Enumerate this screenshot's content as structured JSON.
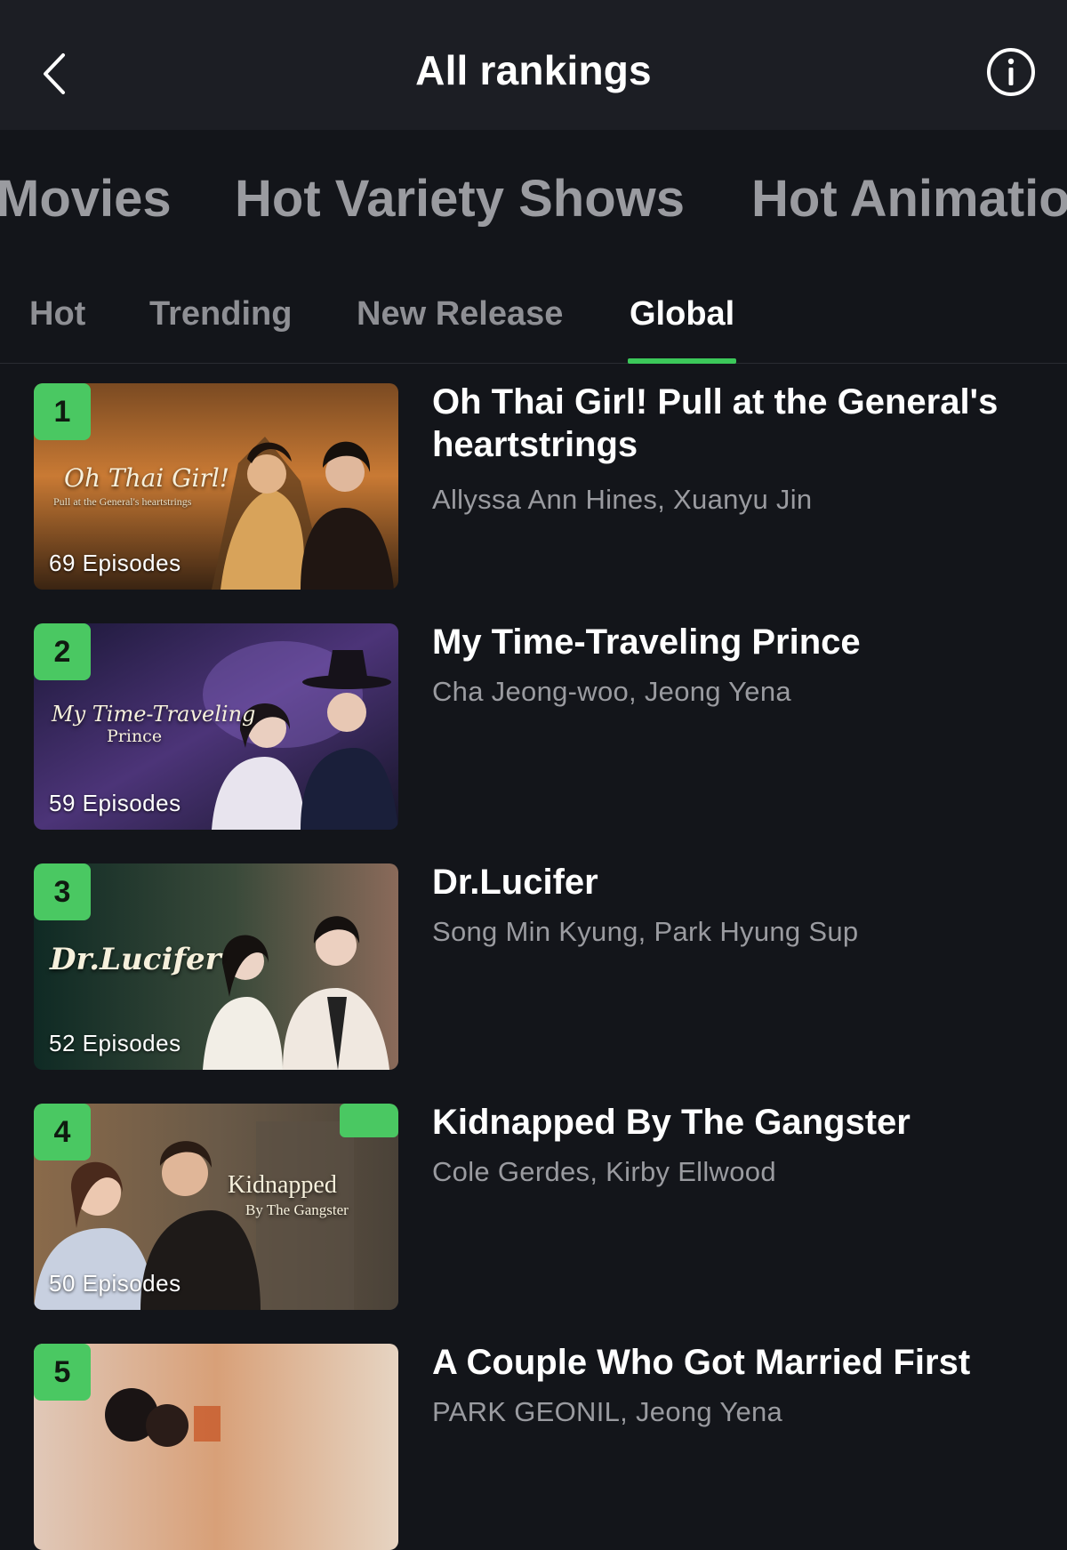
{
  "header": {
    "title": "All rankings",
    "back_icon": "chevron-left-icon",
    "info_icon": "info-circle-icon"
  },
  "category_tabs": [
    "Movies",
    "Hot Variety Shows",
    "Hot Animatio"
  ],
  "sub_tabs": {
    "items": [
      "Hot",
      "Trending",
      "New Release",
      "Global"
    ],
    "active": "Global"
  },
  "colors": {
    "accent": "#4ac862",
    "background": "#13151a",
    "header": "#1c1e24"
  },
  "rankings": [
    {
      "rank": "1",
      "title": "Oh Thai Girl! Pull at the General's heartstrings",
      "cast": "Allyssa Ann Hines, Xuanyu Jin",
      "episodes": "69 Episodes",
      "poster_title": "Oh Thai Girl!",
      "poster_subtitle": "Pull at the General's heartstrings"
    },
    {
      "rank": "2",
      "title": "My Time-Traveling Prince",
      "cast": "Cha Jeong-woo, Jeong Yena",
      "episodes": "59 Episodes",
      "poster_title": "My Time-Traveling",
      "poster_subtitle": "Prince"
    },
    {
      "rank": "3",
      "title": "Dr.Lucifer",
      "cast": "Song Min Kyung, Park Hyung Sup",
      "episodes": "52 Episodes",
      "poster_title": "Dr.Lucifer"
    },
    {
      "rank": "4",
      "title": "Kidnapped By The Gangster",
      "cast": "Cole Gerdes, Kirby Ellwood",
      "episodes": "50 Episodes",
      "poster_title": "Kidnapped",
      "poster_subtitle": "By The Gangster"
    },
    {
      "rank": "5",
      "title": "A Couple Who Got Married First",
      "cast": "PARK GEONIL, Jeong Yena"
    }
  ]
}
